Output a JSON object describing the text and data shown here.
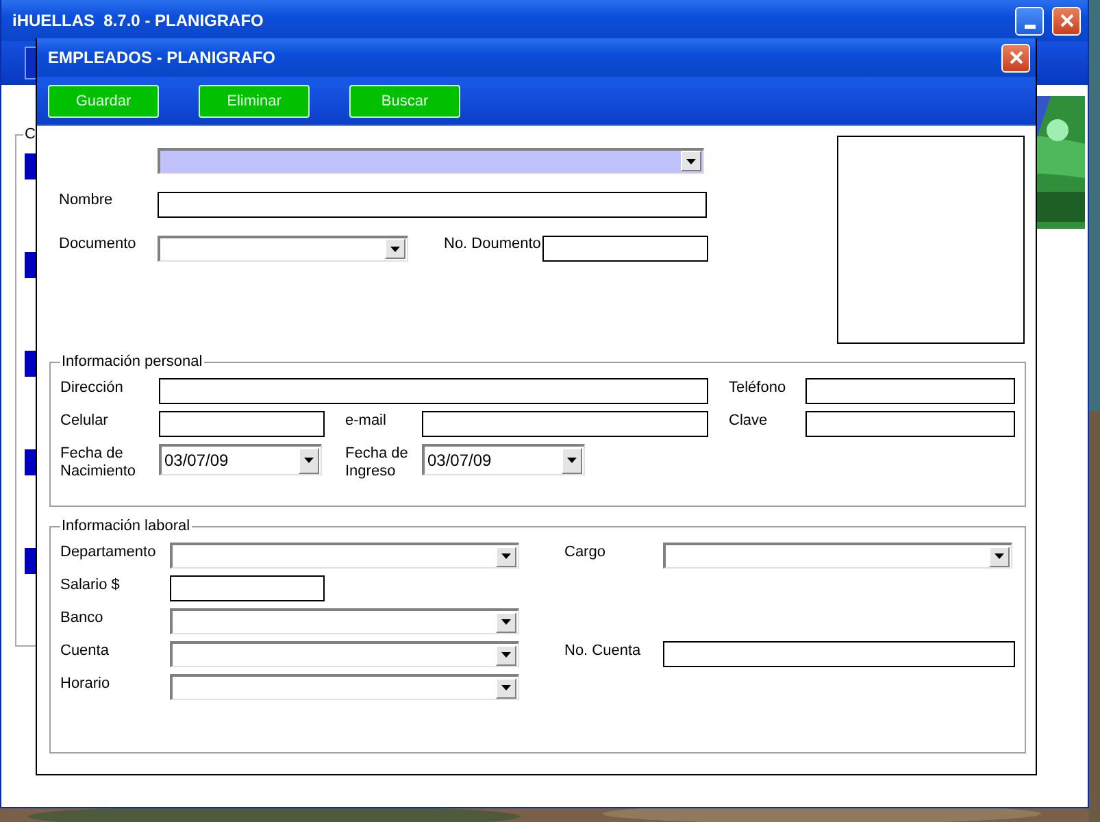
{
  "app_window": {
    "title": "iHUELLAS  8.7.0 - PLANIGRAFO",
    "group_label": "C"
  },
  "dialog": {
    "title": "EMPLEADOS - PLANIGRAFO",
    "buttons": [
      "Guardar",
      "Eliminar",
      "Buscar"
    ]
  },
  "header": {
    "selector": {
      "focused": true
    },
    "name_label": "Nombre",
    "document_label": "Documento",
    "document_number_label": "No. Doumento"
  },
  "personal": {
    "title": "Información personal",
    "address_label": "Dirección",
    "phone_label": "Teléfono",
    "mobile_label": "Celular",
    "email_label": "e-mail",
    "password_label": "Clave",
    "birth_label": "Fecha de Nacimiento",
    "birth_date": "03/07/09",
    "hire_label": "Fecha de Ingreso",
    "hire_date": "03/07/09"
  },
  "work": {
    "title": "Información laboral",
    "department_label": "Departamento",
    "position_label": "Cargo",
    "salary_label": "Salario $",
    "bank_label": "Banco",
    "account_label": "Cuenta",
    "account_number_label": "No. Cuenta",
    "schedule_label": "Horario"
  }
}
